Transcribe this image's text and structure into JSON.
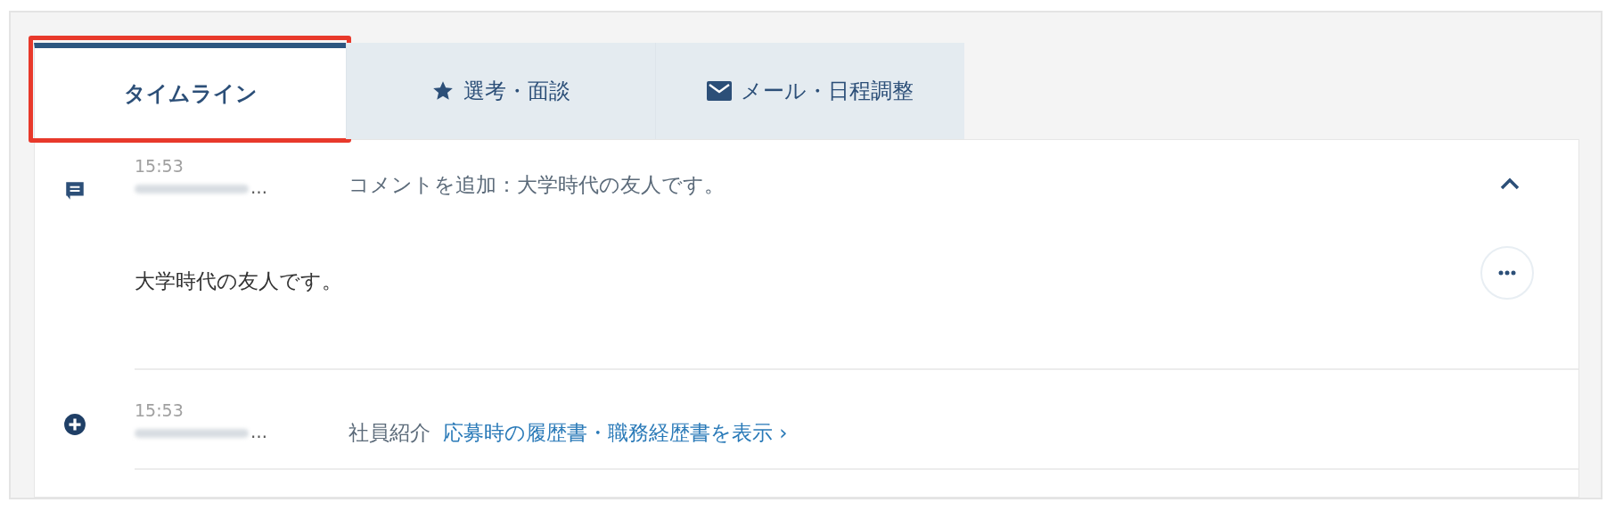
{
  "tabs": [
    {
      "label": "タイムライン",
      "kind": "text",
      "selected": true,
      "highlighted": true
    },
    {
      "label": "選考・面談",
      "kind": "star",
      "selected": false,
      "highlighted": false
    },
    {
      "label": "メール・日程調整",
      "kind": "mail",
      "selected": false,
      "highlighted": false
    }
  ],
  "timeline": [
    {
      "kind": "comment",
      "time": "15:53",
      "author_redacted": true,
      "author_tail": "…",
      "title": "コメントを追加：大学時代の友人です。",
      "expanded": true,
      "body": "大学時代の友人です。"
    },
    {
      "kind": "referral",
      "time": "15:53",
      "author_redacted": true,
      "author_tail": "…",
      "title": "社員紹介",
      "link": "応募時の履歴書・職務経歴書を表示",
      "link_arrow": "›",
      "expanded": false
    }
  ]
}
